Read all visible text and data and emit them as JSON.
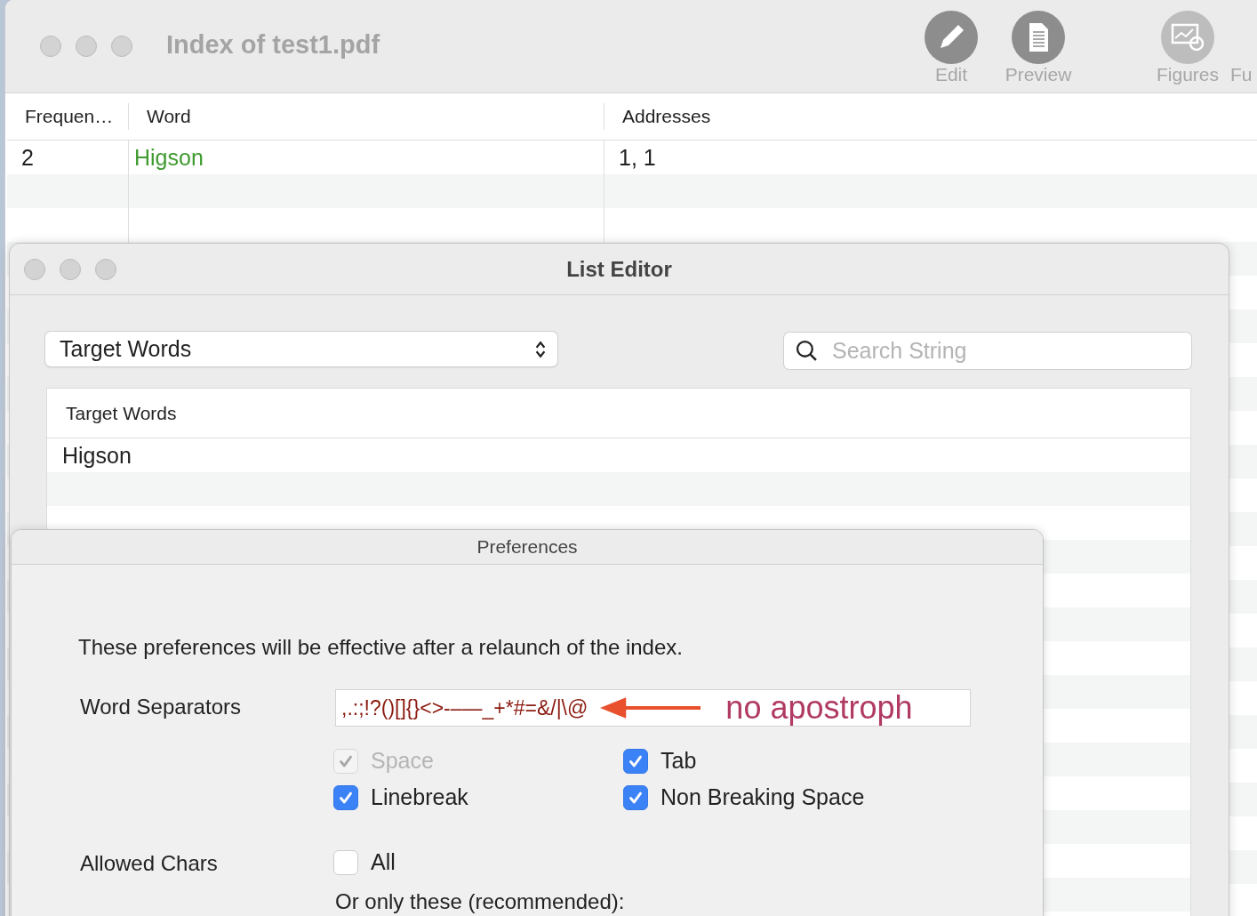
{
  "main_window": {
    "title": "Index of test1.pdf",
    "toolbar": [
      {
        "label": "Edit",
        "kind": "pencil"
      },
      {
        "label": "Preview",
        "kind": "document"
      },
      {
        "label": "Figures",
        "kind": "figure"
      },
      {
        "label": "Fu",
        "kind": "cut"
      }
    ],
    "table": {
      "columns": [
        "Frequen…",
        "Word",
        "Addresses"
      ],
      "rows": [
        {
          "frequency": "2",
          "word": "Higson",
          "addresses": "1, 1"
        }
      ]
    }
  },
  "list_editor": {
    "title": "List Editor",
    "popup": "Target Words",
    "search": {
      "placeholder": "Search String"
    },
    "table": {
      "column": "Target Words",
      "rows": [
        "Higson"
      ]
    }
  },
  "preferences": {
    "title": "Preferences",
    "note": "These preferences will be effective after a relaunch of the index.",
    "word_separators": {
      "label": "Word Separators",
      "value": ",.:;!?()[]{}<>-–—_+*#=&/|\\@",
      "annotation": "no apostroph"
    },
    "separator_options": [
      {
        "label": "Space",
        "checked": true,
        "disabled": true
      },
      {
        "label": "Tab",
        "checked": true,
        "disabled": false
      },
      {
        "label": "Linebreak",
        "checked": true,
        "disabled": false
      },
      {
        "label": "Non Breaking Space",
        "checked": true,
        "disabled": false
      }
    ],
    "allowed_chars": {
      "label": "Allowed Chars",
      "option": {
        "label": "All",
        "checked": false
      },
      "hint": "Or only these (recommended):"
    }
  }
}
